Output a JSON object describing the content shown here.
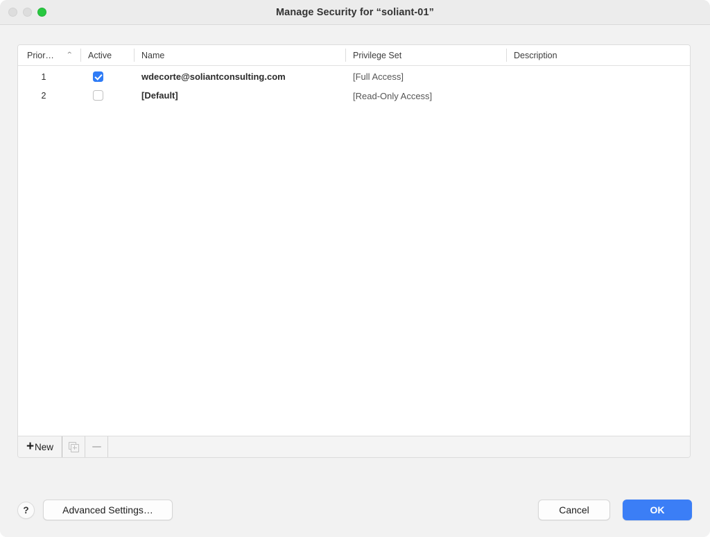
{
  "window": {
    "title": "Manage Security for “soliant-01”",
    "traffic_lights": [
      {
        "name": "close",
        "color": "#dddddd"
      },
      {
        "name": "minimize",
        "color": "#dddddd"
      },
      {
        "name": "zoom",
        "color": "#28c840"
      }
    ]
  },
  "table": {
    "columns": [
      {
        "key": "priority",
        "label": "Prior…",
        "sorted": true,
        "sort_direction": "ascending",
        "sort_glyph": "⌃"
      },
      {
        "key": "active",
        "label": "Active"
      },
      {
        "key": "name",
        "label": "Name"
      },
      {
        "key": "privilege_set",
        "label": "Privilege Set"
      },
      {
        "key": "description",
        "label": "Description"
      }
    ],
    "rows": [
      {
        "priority": "1",
        "active": true,
        "name": "wdecorte@soliantconsulting.com",
        "privilege_set": "[Full Access]",
        "description": ""
      },
      {
        "priority": "2",
        "active": false,
        "name": "[Default]",
        "privilege_set": "[Read-Only Access]",
        "description": ""
      }
    ]
  },
  "toolbar": {
    "new_label": "New",
    "new_plus": "+",
    "duplicate_icon": "duplicate-icon",
    "delete_icon": "minus-icon"
  },
  "footer": {
    "help_label": "?",
    "advanced_label": "Advanced Settings…",
    "cancel_label": "Cancel",
    "ok_label": "OK"
  },
  "colors": {
    "accent": "#3b7ef6",
    "checkbox_on": "#2f7cf6",
    "window_bg": "#f2f2f2",
    "titlebar_bg": "#ececec",
    "zoom_light": "#28c840"
  }
}
